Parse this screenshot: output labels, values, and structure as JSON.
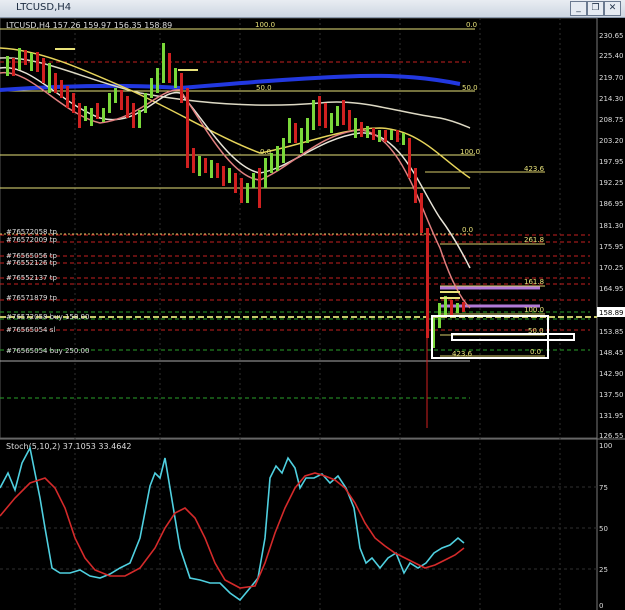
{
  "window": {
    "title": "LTCUSD,H4",
    "buttons": [
      "_",
      "❐",
      "✕"
    ]
  },
  "main_chart": {
    "header": "LTCUSD,H4 157.26 159.97 156.35 158.89",
    "current_price": "158.89",
    "price_axis": [
      "230.65",
      "225.40",
      "219.70",
      "214.30",
      "208.75",
      "203.20",
      "197.95",
      "192.25",
      "186.95",
      "181.30",
      "175.95",
      "170.25",
      "164.95",
      "159.40",
      "153.85",
      "148.45",
      "142.90",
      "137.50",
      "131.95",
      "126.55"
    ],
    "fib_labels": [
      "100.0",
      "0.0",
      "50.0",
      "50.0",
      "0.0",
      "100.0",
      "423.6",
      "0.0",
      "261.8",
      "161.8",
      "100.0",
      "50.0",
      "0.0",
      "423.6"
    ],
    "order_labels": [
      "#76572058 tp",
      "#76572009 tp",
      "#76565056 tp",
      "#76552126 tp",
      "#76552137 tp",
      "#76571879 tp",
      "#76572058 buy 158.00",
      "#76565054 sl",
      "#76565054 buy 250.00"
    ]
  },
  "stoch_panel": {
    "header": "Stoch(5,10,2) 37.1053 33.4642",
    "levels": [
      "100",
      "75",
      "50",
      "25",
      "0"
    ],
    "main_line_color": "#4fd0e0",
    "signal_line_color": "#d42a2a"
  }
}
